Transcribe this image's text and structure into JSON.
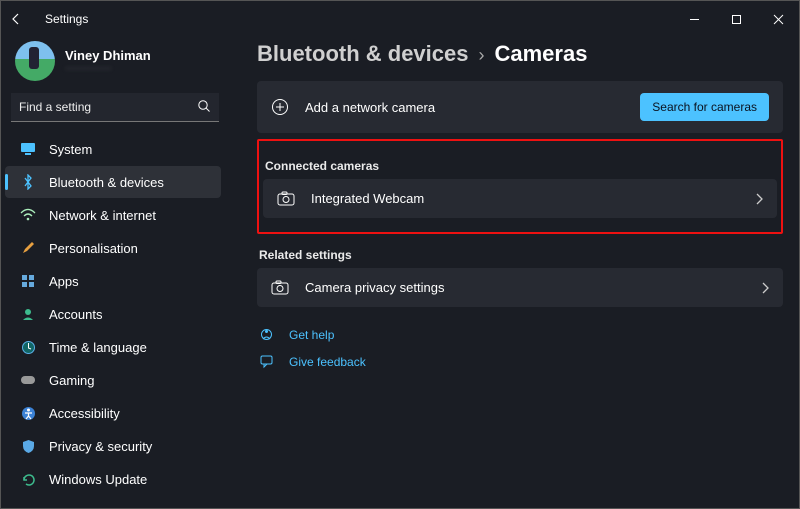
{
  "window": {
    "title": "Settings"
  },
  "user": {
    "name": "Viney Dhiman",
    "email": "··············"
  },
  "search": {
    "placeholder": "Find a setting"
  },
  "sidebar": {
    "items": [
      {
        "label": "System"
      },
      {
        "label": "Bluetooth & devices"
      },
      {
        "label": "Network & internet"
      },
      {
        "label": "Personalisation"
      },
      {
        "label": "Apps"
      },
      {
        "label": "Accounts"
      },
      {
        "label": "Time & language"
      },
      {
        "label": "Gaming"
      },
      {
        "label": "Accessibility"
      },
      {
        "label": "Privacy & security"
      },
      {
        "label": "Windows Update"
      }
    ]
  },
  "breadcrumb": {
    "parent": "Bluetooth & devices",
    "current": "Cameras"
  },
  "actions": {
    "add_network_camera": "Add a network camera",
    "search_cameras": "Search for cameras"
  },
  "sections": {
    "connected": {
      "title": "Connected cameras",
      "items": [
        {
          "label": "Integrated Webcam"
        }
      ]
    },
    "related": {
      "title": "Related settings",
      "items": [
        {
          "label": "Camera privacy settings"
        }
      ]
    }
  },
  "footer_links": {
    "help": "Get help",
    "feedback": "Give feedback"
  }
}
